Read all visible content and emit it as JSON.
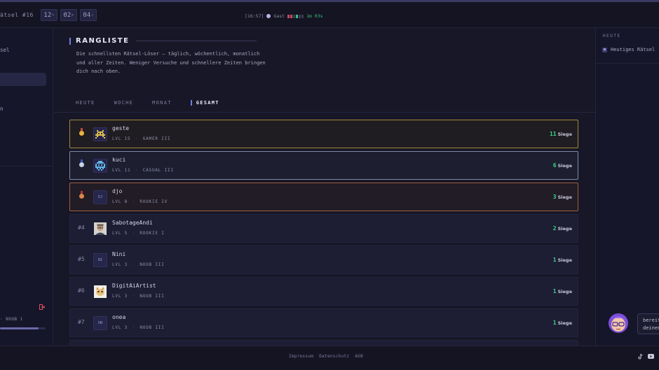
{
  "topbar": {
    "puzzle_label": "ätsel #16",
    "timer": [
      {
        "value": "12",
        "unit": "h"
      },
      {
        "value": "02",
        "unit": "m"
      },
      {
        "value": "04",
        "unit": "s"
      }
    ],
    "clock": "[16:57]",
    "user": "Gast",
    "next_in": "1m 03s"
  },
  "sidebar_left": {
    "item_top": "sel",
    "item_mid": "n",
    "level_text": "· NOOB 1",
    "xp_progress": 0.85
  },
  "main": {
    "title": "RANGLISTE",
    "intro": "Die schnellsten Rätsel-Löser – täglich, wöchentlich, monatlich und aller Zeiten. Weniger Versuche und schnellere Zeiten bringen dich nach oben.",
    "tabs": [
      {
        "label": "HEUTE",
        "active": false
      },
      {
        "label": "WOCHE",
        "active": false
      },
      {
        "label": "MONAT",
        "active": false
      },
      {
        "label": "GESAMT",
        "active": true
      }
    ],
    "wins_label": "Siege",
    "level_prefix": "LVL",
    "rows": [
      {
        "rank": "",
        "medal": "gold",
        "avatar": "invader",
        "initials": "",
        "name": "geste",
        "level": "15",
        "tier": "GAMER III",
        "wins": "11"
      },
      {
        "rank": "",
        "medal": "silver",
        "avatar": "crab",
        "initials": "",
        "name": "kuci",
        "level": "11",
        "tier": "CASUAL III",
        "wins": "6"
      },
      {
        "rank": "",
        "medal": "bronze",
        "avatar": "initials",
        "initials": "DJ",
        "name": "djo",
        "level": "8",
        "tier": "ROOKIE IV",
        "wins": "3"
      },
      {
        "rank": "#4",
        "medal": "",
        "avatar": "photo",
        "initials": "",
        "name": "SabotageAndi",
        "level": "5",
        "tier": "ROOKIE I",
        "wins": "2"
      },
      {
        "rank": "#5",
        "medal": "",
        "avatar": "initials",
        "initials": "NI",
        "name": "Nini",
        "level": "3",
        "tier": "NOOB III",
        "wins": "1"
      },
      {
        "rank": "#6",
        "medal": "",
        "avatar": "art",
        "initials": "",
        "name": "DigitAiArtist",
        "level": "3",
        "tier": "NOOB III",
        "wins": "1"
      },
      {
        "rank": "#7",
        "medal": "",
        "avatar": "initials",
        "initials": "ON",
        "name": "onea",
        "level": "3",
        "tier": "NOOB III",
        "wins": "1"
      },
      {
        "rank": "",
        "medal": "",
        "avatar": "initials",
        "initials": "",
        "name": "",
        "level": "",
        "tier": "",
        "wins": ""
      }
    ]
  },
  "sidebar_right": {
    "heading": "HEUTE",
    "item": "Heutiges Rätsel",
    "bubble_line1": "bereit",
    "bubble_line2": "deinen"
  },
  "footer": {
    "links": [
      "Impressum",
      "Datenschutz",
      "AGB"
    ]
  },
  "colors": {
    "accent": "#6f7ee8",
    "wins": "#3fd48a",
    "gold": "#a08a3a",
    "silver": "#7f8aa6",
    "bronze": "#a0603a",
    "logout": "#e05060"
  },
  "icons": [
    "logout-icon",
    "puzzle-icon",
    "tiktok-icon",
    "youtube-icon",
    "medal-icon"
  ]
}
